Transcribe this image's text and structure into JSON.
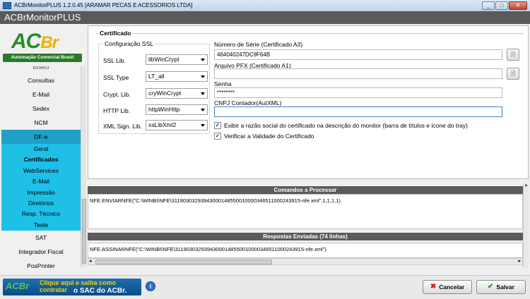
{
  "window": {
    "title": "ACBrMonitorPLUS 1.2.0.45  [ARAMAR PECAS E ACESSORIOS LTDA]",
    "min": "_",
    "max": "□",
    "close": "✕"
  },
  "app": {
    "title": "ACBrMonitorPLUS"
  },
  "logo": {
    "ac": "AC",
    "br": "Br",
    "tagline": "Automação Comercial Brasil"
  },
  "sidebar": {
    "cut_item": "Boleto",
    "items_top": [
      "Consultas",
      "E-Mail",
      "Sedex",
      "NCM"
    ],
    "dfe": "DF-e",
    "sub_items": [
      "Geral",
      "Certificados",
      "WebServices",
      "E-Mail",
      "Impressão",
      "Diretórios",
      "Resp. Técnico",
      "Teste"
    ],
    "items_bottom": [
      "SAT",
      "Integrador Fiscal",
      "PosPrinter"
    ]
  },
  "cert": {
    "group_title": "Certificado",
    "ssl_title": "Configuração SSL",
    "ssl": [
      {
        "label": "SSL Lib.",
        "value": "libWinCrypt"
      },
      {
        "label": "SSL Type",
        "value": "LT_all"
      },
      {
        "label": "Crypt. Lib.",
        "value": "cryWinCrypt"
      },
      {
        "label": "HTTP Lib.",
        "value": "httpWinHttp"
      },
      {
        "label": "XML Sign. Lib.",
        "value": "xsLibXml2"
      }
    ],
    "serial_label": "Número de Série (Certificado A3)",
    "serial_value": "464040247DC9F64B",
    "pfx_label": "Arquivo PFX (Certificado A1)",
    "pfx_value": "",
    "password_label": "Senha",
    "password_value": "********",
    "cnpj_label": "CNPJ Contador(AutXML)",
    "cnpj_value": "",
    "check1_label": "Exibir a razão social do certificado na descrição do monitor (barra de títulos e icone do tray)",
    "check2_label": "Verificar a Validade do Certificado",
    "check1": true,
    "check2": true
  },
  "commands": {
    "title": "Comandos a Processar",
    "line": "NFE.ENVIARNFE(\"C:\\WINBI\\NFE\\31190303293943000148550010000346511000243915-nfe.xml\",1,1,1,1)"
  },
  "responses": {
    "title": "Respostas Enviadas (74 linhas)",
    "line": "NFE.ASSINARNFE(\"C:\\WINBI\\NFE\\31190303293943000148550010000346511000243915-nfe.xml\")"
  },
  "footer": {
    "banner_logo": "ACBr",
    "banner_line1": "Clique aqui e saiba como contratar",
    "banner_line2": "o SAC do ACBr.",
    "info": "i",
    "cancel": "Cancelar",
    "save": "Salvar"
  }
}
